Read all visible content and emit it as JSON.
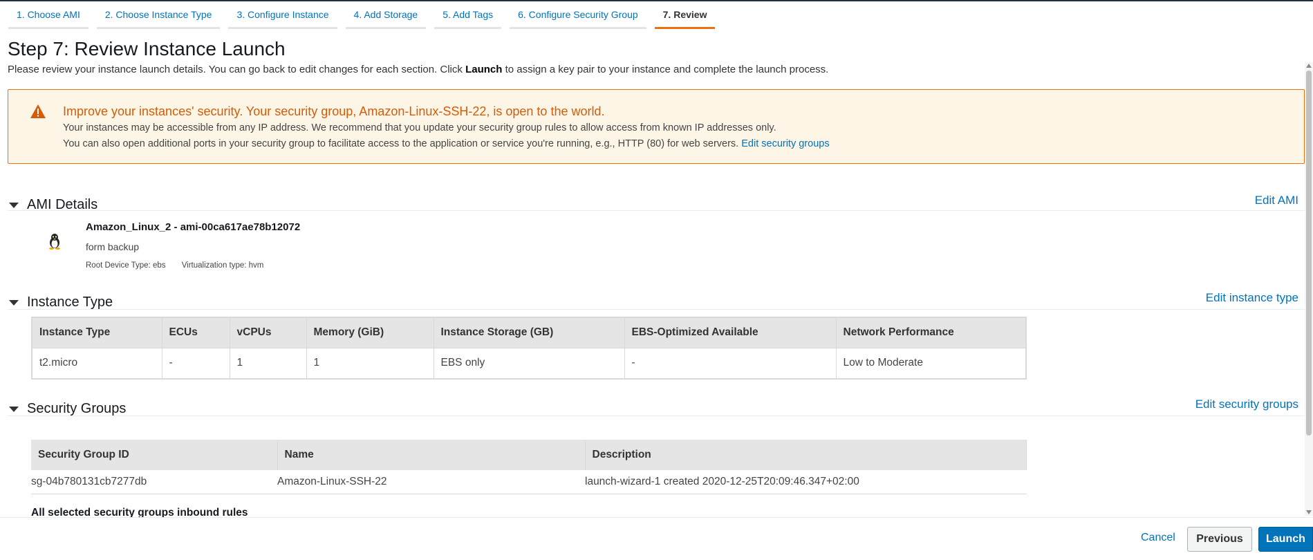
{
  "wizard": {
    "steps": [
      {
        "label": "1. Choose AMI"
      },
      {
        "label": "2. Choose Instance Type"
      },
      {
        "label": "3. Configure Instance"
      },
      {
        "label": "4. Add Storage"
      },
      {
        "label": "5. Add Tags"
      },
      {
        "label": "6. Configure Security Group"
      },
      {
        "label": "7. Review"
      }
    ],
    "active_step": "7. Review"
  },
  "header": {
    "title": "Step 7: Review Instance Launch",
    "intro_before": "Please review your instance launch details. You can go back to edit changes for each section. Click ",
    "intro_bold": "Launch",
    "intro_after": " to assign a key pair to your instance and complete the launch process."
  },
  "warning": {
    "icon": "warning-triangle-icon",
    "title": "Improve your instances' security. Your security group, Amazon-Linux-SSH-22, is open to the world.",
    "line1": "Your instances may be accessible from any IP address. We recommend that you update your security group rules to allow access from known IP addresses only.",
    "line2": "You can also open additional ports in your security group to facilitate access to the application or service you're running, e.g., HTTP (80) for web servers.",
    "link": "Edit security groups"
  },
  "ami": {
    "section_title": "AMI Details",
    "edit_label": "Edit AMI",
    "icon": "linux-penguin-icon",
    "name": "Amazon_Linux_2 - ami-00ca617ae78b12072",
    "description": "form backup",
    "root_device": "Root Device Type: ebs",
    "virtualization": "Virtualization type: hvm"
  },
  "instance_type": {
    "section_title": "Instance Type",
    "edit_label": "Edit instance type",
    "columns": [
      "Instance Type",
      "ECUs",
      "vCPUs",
      "Memory (GiB)",
      "Instance Storage (GB)",
      "EBS-Optimized Available",
      "Network Performance"
    ],
    "row": [
      "t2.micro",
      "-",
      "1",
      "1",
      "EBS only",
      "-",
      "Low to Moderate"
    ]
  },
  "security_groups": {
    "section_title": "Security Groups",
    "edit_label": "Edit security groups",
    "columns": [
      "Security Group ID",
      "Name",
      "Description"
    ],
    "row": [
      "sg-04b780131cb7277db",
      "Amazon-Linux-SSH-22",
      "launch-wizard-1 created 2020-12-25T20:09:46.347+02:00"
    ],
    "inbound_title": "All selected security groups inbound rules"
  },
  "footer": {
    "cancel": "Cancel",
    "previous": "Previous",
    "launch": "Launch"
  }
}
